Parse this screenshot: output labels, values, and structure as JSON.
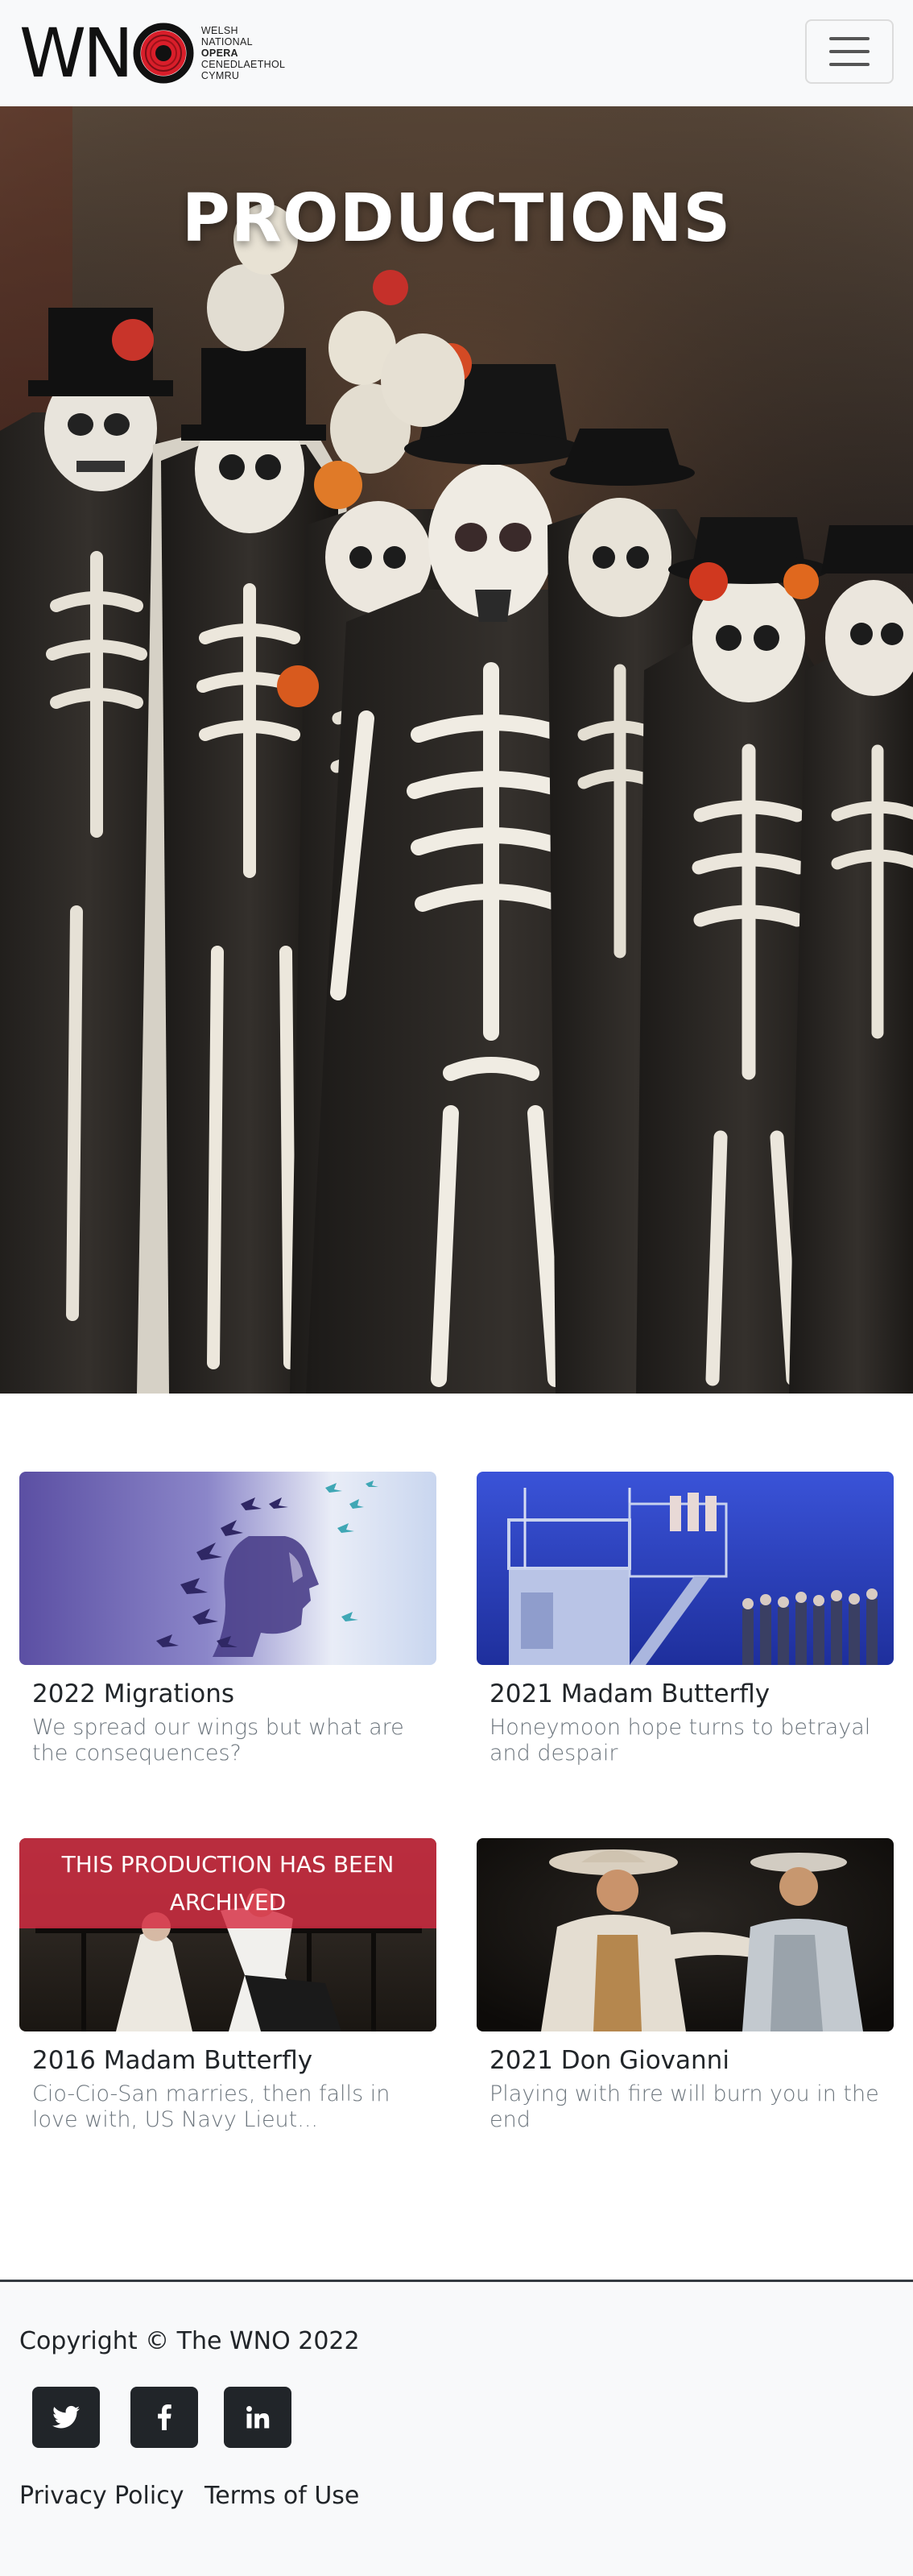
{
  "brand": {
    "logo_letters": "WN",
    "logo_text_lines": [
      "WELSH",
      "NATIONAL",
      "OPERA",
      "CENEDLAETHOL",
      "CYMRU"
    ],
    "accent_color": "#e3202e"
  },
  "navbar": {
    "toggler_icon": "hamburger-menu-icon"
  },
  "hero": {
    "title": "PRODUCTIONS"
  },
  "productions": [
    {
      "title": "2022 Migrations",
      "description": "We spread our wings but what are the consequences?",
      "archived": false
    },
    {
      "title": "2021 Madam Butterfly",
      "description": "Honeymoon hope turns to betrayal and despair",
      "archived": false
    },
    {
      "title": "2016 Madam Butterfly",
      "description": "Cio-Cio-San marries, then falls in love with, US Navy Lieut...",
      "archived": true,
      "badge": "THIS PRODUCTION HAS BEEN ARCHIVED"
    },
    {
      "title": "2021 Don Giovanni",
      "description": "Playing with fire will burn you in the end",
      "archived": false
    }
  ],
  "footer": {
    "copyright": "Copyright © The WNO 2022",
    "social": [
      {
        "name": "twitter",
        "icon": "twitter-icon"
      },
      {
        "name": "facebook",
        "icon": "facebook-icon"
      },
      {
        "name": "linkedin",
        "icon": "linkedin-icon"
      }
    ],
    "links": [
      "Privacy Policy",
      "Terms of Use"
    ]
  }
}
